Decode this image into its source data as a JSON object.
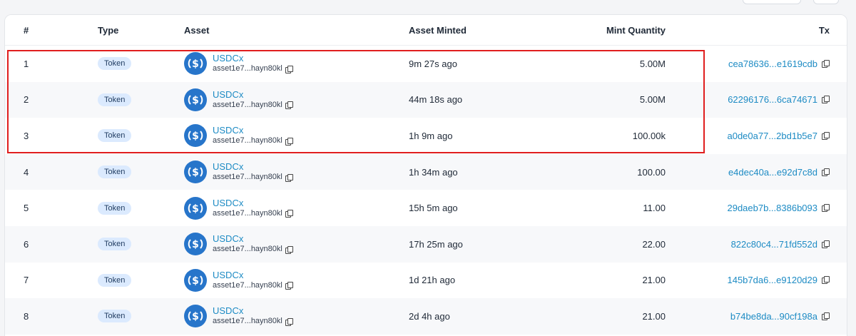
{
  "table": {
    "headers": {
      "num": "#",
      "type": "Type",
      "asset": "Asset",
      "minted": "Asset Minted",
      "qty": "Mint Quantity",
      "tx": "Tx"
    },
    "rows": [
      {
        "num": "1",
        "type": "Token",
        "asset_name": "USDCx",
        "asset_id": "asset1e7...hayn80kl",
        "minted": "9m 27s ago",
        "qty": "5.00M",
        "tx": "cea78636...e1619cdb"
      },
      {
        "num": "2",
        "type": "Token",
        "asset_name": "USDCx",
        "asset_id": "asset1e7...hayn80kl",
        "minted": "44m 18s ago",
        "qty": "5.00M",
        "tx": "62296176...6ca74671"
      },
      {
        "num": "3",
        "type": "Token",
        "asset_name": "USDCx",
        "asset_id": "asset1e7...hayn80kl",
        "minted": "1h 9m ago",
        "qty": "100.00k",
        "tx": "a0de0a77...2bd1b5e7"
      },
      {
        "num": "4",
        "type": "Token",
        "asset_name": "USDCx",
        "asset_id": "asset1e7...hayn80kl",
        "minted": "1h 34m ago",
        "qty": "100.00",
        "tx": "e4dec40a...e92d7c8d"
      },
      {
        "num": "5",
        "type": "Token",
        "asset_name": "USDCx",
        "asset_id": "asset1e7...hayn80kl",
        "minted": "15h 5m ago",
        "qty": "11.00",
        "tx": "29daeb7b...8386b093"
      },
      {
        "num": "6",
        "type": "Token",
        "asset_name": "USDCx",
        "asset_id": "asset1e7...hayn80kl",
        "minted": "17h 25m ago",
        "qty": "22.00",
        "tx": "822c80c4...71fd552d"
      },
      {
        "num": "7",
        "type": "Token",
        "asset_name": "USDCx",
        "asset_id": "asset1e7...hayn80kl",
        "minted": "1d 21h ago",
        "qty": "21.00",
        "tx": "145b7da6...e9120d29"
      },
      {
        "num": "8",
        "type": "Token",
        "asset_name": "USDCx",
        "asset_id": "asset1e7...hayn80kl",
        "minted": "2d 4h ago",
        "qty": "21.00",
        "tx": "b74be8da...90cf198a"
      }
    ]
  },
  "icons": {
    "asset": "usdc-coin-icon",
    "copy": "copy-icon"
  },
  "colors": {
    "link": "#1d8bc4",
    "badge_bg": "#dbeafe",
    "usdc": "#2775ca",
    "highlight": "#e01e1e"
  }
}
